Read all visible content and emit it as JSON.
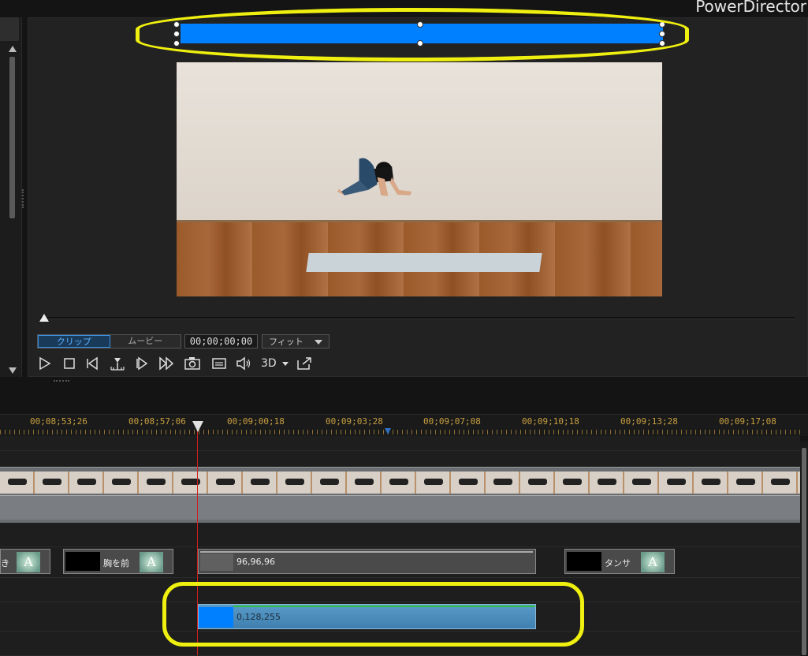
{
  "app": {
    "title": "PowerDirector"
  },
  "preview": {
    "modes": [
      {
        "label": "クリップ",
        "active": true
      },
      {
        "label": "ムービー",
        "active": false
      }
    ],
    "timecode": "00;00;00;00",
    "zoom": {
      "selected": "フィット"
    },
    "controls": {
      "play": "play-icon",
      "stop": "stop-icon",
      "prev_frame": "previous-frame-icon",
      "split": "split-icon",
      "next_frame": "next-frame-icon",
      "fast_forward": "fast-forward-icon",
      "snapshot": "camera-icon",
      "subtitle": "subtitle-icon",
      "volume": "volume-icon",
      "threed_label": "3D",
      "undock": "undock-icon"
    },
    "title_object": {
      "color": "#0080FF"
    }
  },
  "timeline": {
    "ruler": [
      "00;08;53;26",
      "00;08;57;06",
      "00;09;00;18",
      "00;09;03;28",
      "00;09;07;08",
      "00;09;10;18",
      "00;09;13;28",
      "00;09;17;08"
    ],
    "title_track": {
      "clips": [
        {
          "label": "き"
        },
        {
          "label": "胸を前"
        },
        {
          "label": "96,96,96"
        },
        {
          "label": "タンサ"
        }
      ]
    },
    "color_clip": {
      "label": "0,128,255",
      "color": "#0080FF"
    }
  },
  "annotations": {
    "highlight_color": "#F0F010"
  }
}
